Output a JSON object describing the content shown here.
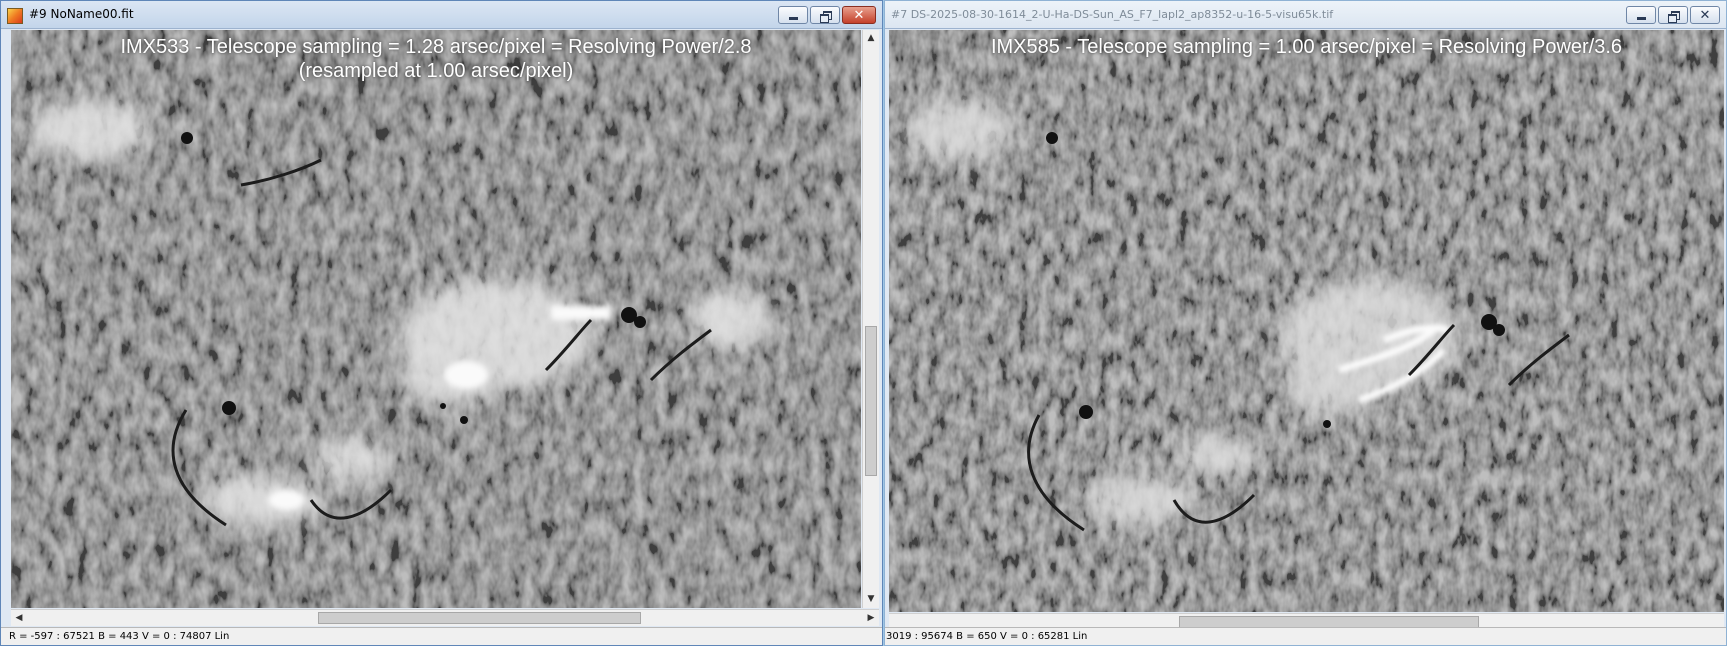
{
  "left_window": {
    "title": "#9 NoName00.fit",
    "caption_line1": "IMX533 - Telescope sampling = 1.28 arsec/pixel = Resolving Power/2.8",
    "caption_line2": "(resampled at 1.00 arsec/pixel)",
    "status": "R = -597 : 67521   B = 443   V = 0 : 74807 Lin",
    "scroll": {
      "vertical_position": 0.55,
      "horizontal_position": 0.5
    }
  },
  "right_window": {
    "title": "#7 DS-2025-08-30-1614_2-U-Ha-DS-Sun_AS_F7_lapl2_ap8352-u-16-5-visu65k.tif",
    "caption_line1": "IMX585 - Telescope sampling = 1.00 arsec/pixel = Resolving Power/3.6",
    "status": "3019 : 95674   B = 650   V = 0 : 65281 Lin",
    "scroll": {
      "horizontal_position": 0.55
    }
  },
  "controls": {
    "minimize_icon": "minimize-icon",
    "maximize_icon": "maximize-icon",
    "restore_icon": "restore-icon",
    "close_icon": "close-icon",
    "close_glyph": "✕",
    "arrow_up": "▲",
    "arrow_down": "▼",
    "arrow_left": "◀",
    "arrow_right": "▶"
  },
  "colors": {
    "close_red": "#c4402a",
    "image_gray": "#7d7d7d"
  }
}
